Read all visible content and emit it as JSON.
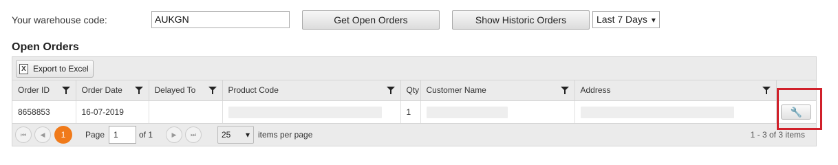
{
  "form": {
    "warehouse_label": "Your warehouse code:",
    "warehouse_value": "AUKGN",
    "get_open_orders": "Get Open Orders",
    "show_historic_orders": "Show Historic Orders",
    "period_selected": "Last 7 Days",
    "period_arrow": "▾"
  },
  "section_title": "Open Orders",
  "toolbar": {
    "excel_icon": "X",
    "export_label": "Export to Excel"
  },
  "columns": [
    "Order ID",
    "Order Date",
    "Delayed To",
    "Product Code",
    "Qty",
    "Customer Name",
    "Address"
  ],
  "rows": [
    {
      "order_id": "8658853",
      "order_date": "16-07-2019",
      "delayed_to": "",
      "product_code": "",
      "qty": "1",
      "customer_name": "",
      "address": ""
    }
  ],
  "icons": {
    "wrench": "🔧"
  },
  "pager": {
    "first": "⏮",
    "prev": "◀",
    "current_page": "1",
    "page_label": "Page",
    "page_value": "1",
    "of_label": "of 1",
    "next": "▶",
    "last": "⏭",
    "page_size": "25",
    "page_size_arrow": "▾",
    "items_per_page": "items per page",
    "range_text": "1 - 3 of 3 items"
  },
  "colors": {
    "accent_orange": "#f07a1a",
    "highlight_red": "#d0202a"
  }
}
